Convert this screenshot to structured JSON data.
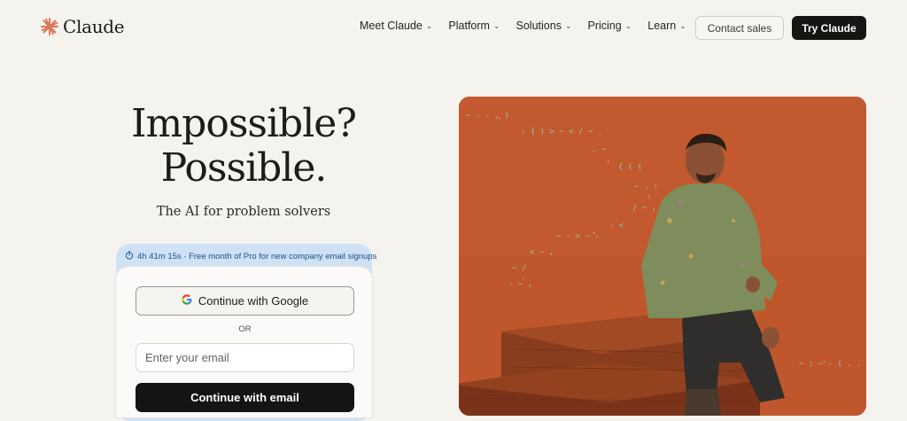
{
  "brand": {
    "name": "Claude"
  },
  "nav": {
    "items": [
      {
        "label": "Meet Claude"
      },
      {
        "label": "Platform"
      },
      {
        "label": "Solutions"
      },
      {
        "label": "Pricing"
      },
      {
        "label": "Learn"
      }
    ],
    "contact_label": "Contact sales",
    "try_label": "Try Claude"
  },
  "hero": {
    "title_line1": "Impossible?",
    "title_line2": "Possible.",
    "subtitle": "The AI for problem solvers"
  },
  "signup": {
    "promo": "4h 41m 15s · Free month of Pro for new company email signups",
    "google_label": "Continue with Google",
    "or_label": "OR",
    "email_placeholder": "Enter your email",
    "email_button": "Continue with email"
  },
  "colors": {
    "accent": "#d97757",
    "background": "#f5f3ee",
    "photo_background": "#c0562c",
    "promo_background": "#cfe1f5"
  }
}
